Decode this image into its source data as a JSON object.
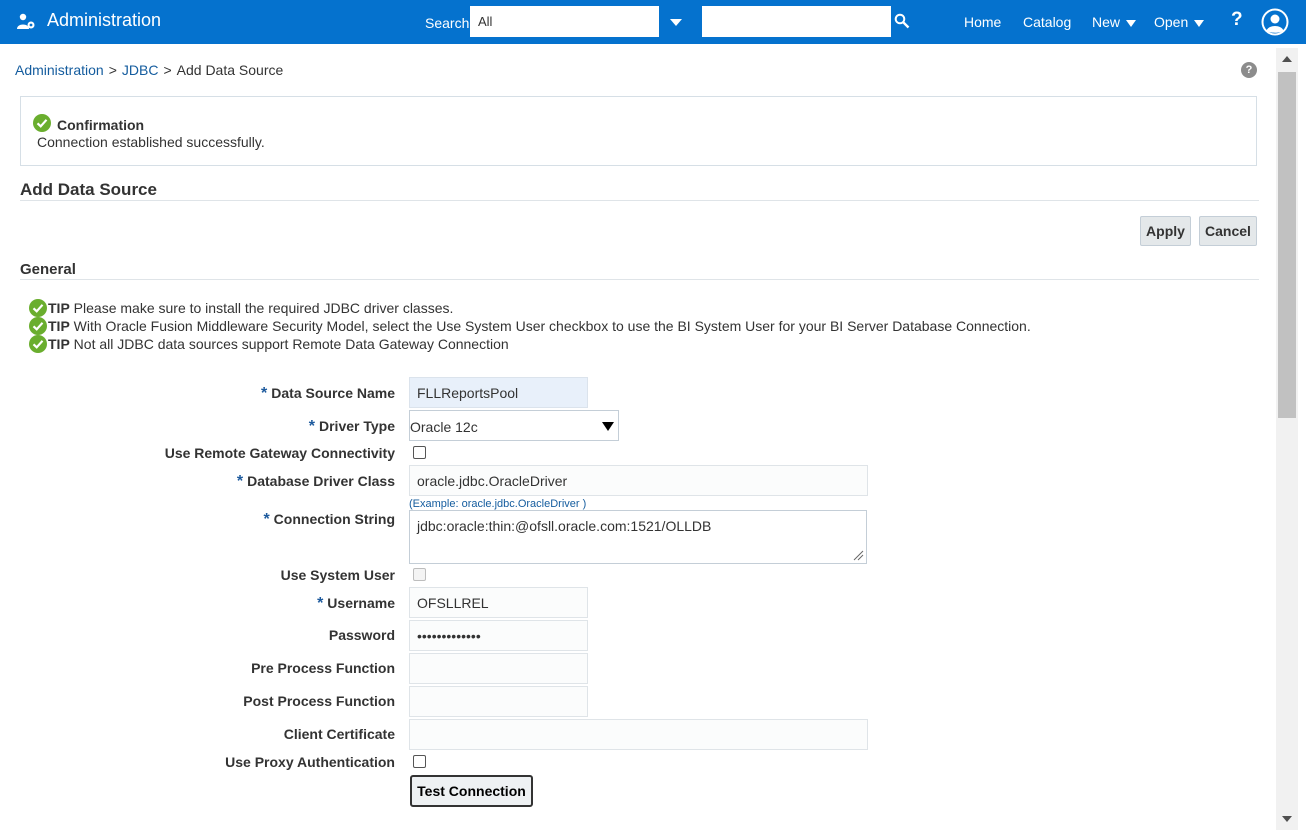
{
  "header": {
    "app_title": "Administration",
    "search_label": "Search",
    "search_scope": "All",
    "search_query": "",
    "nav": {
      "home": "Home",
      "catalog": "Catalog",
      "new": "New",
      "open": "Open",
      "help": "?"
    }
  },
  "breadcrumb": {
    "items": [
      "Administration",
      "JDBC",
      "Add Data Source"
    ],
    "separator": ">"
  },
  "confirmation": {
    "title": "Confirmation",
    "message": "Connection established successfully."
  },
  "page_title": "Add Data Source",
  "actions": {
    "apply": "Apply",
    "cancel": "Cancel"
  },
  "general": {
    "title": "General",
    "tips": [
      {
        "label": "TIP",
        "text": "Please make sure to install the required JDBC driver classes."
      },
      {
        "label": "TIP",
        "text": "With Oracle Fusion Middleware Security Model, select the Use System User checkbox to use the BI System User for your BI Server Database Connection."
      },
      {
        "label": "TIP",
        "text": "Not all JDBC data sources support Remote Data Gateway Connection"
      }
    ]
  },
  "form": {
    "required_mark": "*",
    "data_source_name": {
      "label": "Data Source Name",
      "value": "FLLReportsPool"
    },
    "driver_type": {
      "label": "Driver Type",
      "value": "Oracle 12c"
    },
    "remote_gateway": {
      "label": "Use Remote Gateway Connectivity",
      "checked": false
    },
    "driver_class": {
      "label": "Database Driver Class",
      "value": "oracle.jdbc.OracleDriver",
      "example": "(Example: oracle.jdbc.OracleDriver )"
    },
    "connection_string": {
      "label": "Connection String",
      "value": "jdbc:oracle:thin:@ofsll.oracle.com:1521/OLLDB"
    },
    "system_user": {
      "label": "Use System User",
      "checked": false
    },
    "username": {
      "label": "Username",
      "value": "OFSLLREL"
    },
    "password": {
      "label": "Password",
      "value": "•••••••••••••"
    },
    "pre_process": {
      "label": "Pre Process Function",
      "value": ""
    },
    "post_process": {
      "label": "Post Process Function",
      "value": ""
    },
    "client_certificate": {
      "label": "Client Certificate",
      "value": ""
    },
    "proxy_auth": {
      "label": "Use Proxy Authentication",
      "checked": false
    },
    "test_connection": "Test Connection"
  },
  "colors": {
    "header_bg": "#0572ce",
    "link": "#145c9e",
    "success": "#6aae2e"
  }
}
